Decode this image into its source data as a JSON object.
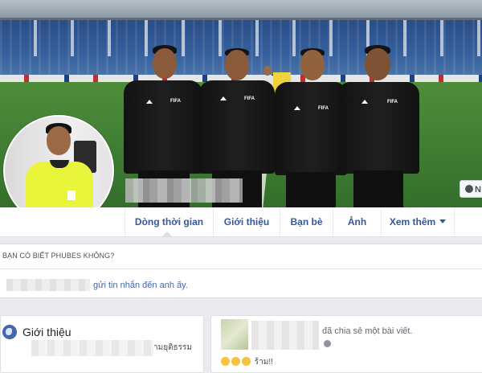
{
  "profile": {
    "cover_alt": "stadium-cover-photo",
    "message_button_label": "N"
  },
  "nav": {
    "tabs": [
      {
        "label": "Dòng thời gian",
        "active": true
      },
      {
        "label": "Giới thiệu"
      },
      {
        "label": "Bạn bè"
      },
      {
        "label": "Ảnh"
      },
      {
        "label": "Xem thêm",
        "has_dropdown": true
      }
    ]
  },
  "know_card": {
    "title": "BẠN CÓ BIẾT PHUBES KHÔNG?",
    "action_text": "gửi tin nhắn đến anh ấy."
  },
  "intro_card": {
    "title": "Giới thiệu",
    "trailing_text": "ามยุติธรรม"
  },
  "post_card": {
    "shared_text": "đã chia sẻ một bài viết.",
    "reaction_text": "ร้าม!!"
  },
  "colors": {
    "link": "#4267b2",
    "nav_text": "#365899",
    "page_bg": "#e9ebee"
  },
  "icons": {
    "intro": "globe-icon",
    "privacy": "globe-small-icon",
    "messenger": "messenger-icon",
    "dropdown": "chevron-down-icon"
  }
}
